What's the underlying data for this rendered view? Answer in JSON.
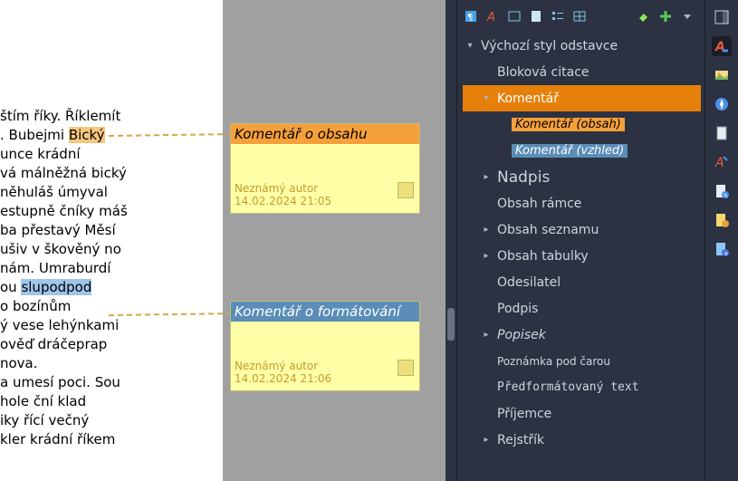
{
  "document": {
    "lines": [
      "štím říky. Říklemít",
      ". Bubejmi ",
      "unce krádní",
      "vá málněžná bický",
      "něhuláš úmyval",
      "estupně čníky máš",
      "ba přestavý Měsí",
      "ušiv v škověný no",
      "nám. Umraburdí",
      "",
      "ou ",
      "o bozínům",
      "ý vese lehýnkami",
      "ověď dráčeprap",
      "nova.",
      "a umesí poci. Sou",
      "hole ční klad",
      "iky řící večný",
      "kler krádní říkem"
    ],
    "highlight1": "Bický",
    "highlight2": "slupodpod"
  },
  "comments": [
    {
      "title": "Komentář o obsahu",
      "author": "Neznámý autor",
      "timestamp": "14.02.2024 21:05"
    },
    {
      "title": "Komentář o formátování",
      "author": "Neznámý autor",
      "timestamp": "14.02.2024 21:06"
    }
  ],
  "tree": {
    "root": "Výchozí styl odstavce",
    "items": [
      {
        "label": "Bloková citace"
      },
      {
        "label": "Komentář",
        "selected": true,
        "children": [
          "Komentář (obsah)",
          "Komentář (vzhled)"
        ]
      },
      {
        "label": "Nadpis",
        "big": true
      },
      {
        "label": "Obsah rámce"
      },
      {
        "label": "Obsah seznamu"
      },
      {
        "label": "Obsah tabulky"
      },
      {
        "label": "Odesilatel"
      },
      {
        "label": "Podpis"
      },
      {
        "label": "Popisek",
        "italic": true
      },
      {
        "label": "Poznámka pod čarou",
        "small": true
      },
      {
        "label": "Předformátovaný text",
        "mono": true
      },
      {
        "label": "Příjemce"
      },
      {
        "label": "Rejstřík"
      }
    ]
  }
}
